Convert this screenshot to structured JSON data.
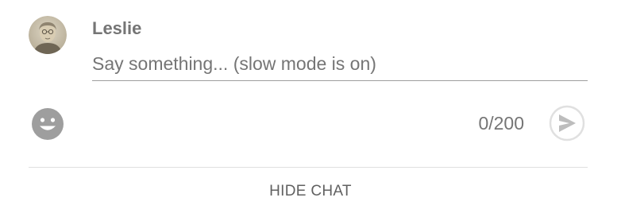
{
  "author": {
    "name": "Leslie",
    "avatar_icon": "sepia-portrait-avatar"
  },
  "input": {
    "placeholder": "Say something... (slow mode is on)",
    "value": ""
  },
  "toolbar": {
    "emoji_icon": "smiley-face-icon",
    "char_count": "0/200",
    "send_icon": "send-arrow-icon"
  },
  "footer": {
    "hide_chat_label": "HIDE CHAT"
  },
  "colors": {
    "text_secondary": "#757575",
    "icon_gray": "#9e9e9e",
    "divider": "#e0e0e0"
  }
}
